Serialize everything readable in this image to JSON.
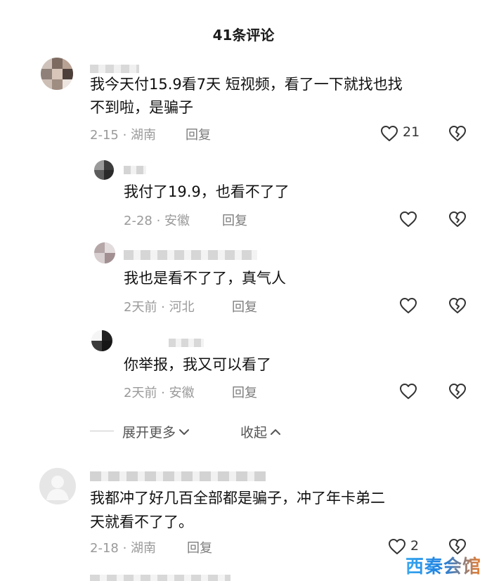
{
  "header": {
    "title": "41条评论"
  },
  "comments": [
    {
      "text_line1": "我今天付15.9看7天 短视频，看了一下就找也找",
      "text_line2": "不到啦，是骗子",
      "time_location": "2-15 · 湖南",
      "reply_label": "回复",
      "like_count": "21"
    },
    {
      "text_line1": "我付了19.9，也看不了了",
      "time_location": "2-28 · 安徽",
      "reply_label": "回复"
    },
    {
      "text_line1": "我也是看不了了，真气人",
      "time_location": "2天前 · 河北",
      "reply_label": "回复"
    },
    {
      "text_line1": "你举报，我又可以看了",
      "time_location": "2天前 · 安徽",
      "reply_label": "回复"
    },
    {
      "text_line1": "我都冲了好几百全部都是骗子，冲了年卡弟二",
      "text_line2": "天就看不了了。",
      "time_location": "2-18 · 湖南",
      "reply_label": "回复",
      "like_count": "2"
    }
  ],
  "thread_controls": {
    "expand_label": "展开更多",
    "collapse_label": "收起"
  },
  "watermark": {
    "text": "西秦会馆"
  },
  "icons": {
    "like": "heart-outline-icon",
    "dislike": "broken-heart-icon",
    "expand": "chevron-down-icon",
    "collapse": "chevron-up-icon"
  },
  "colors": {
    "text": "#111111",
    "meta": "#9a9a9a",
    "icon": "#333333",
    "watermark_start": "#39a8f0",
    "watermark_end": "#f07f2b"
  }
}
